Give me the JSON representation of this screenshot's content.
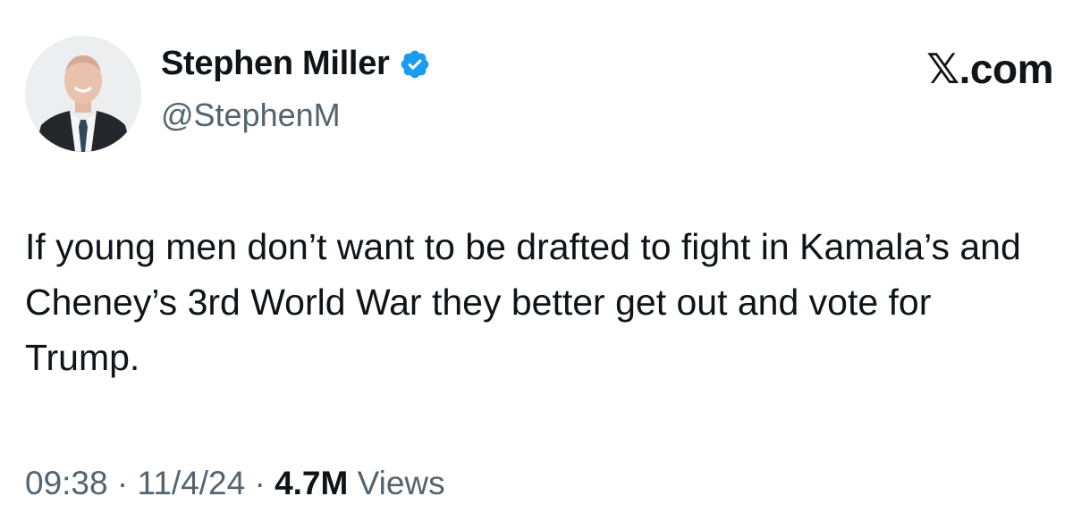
{
  "author": {
    "display_name": "Stephen Miller",
    "handle": "@StephenM",
    "verified": true,
    "verified_color": "#1d9bf0"
  },
  "brand": {
    "label": "𝕏.com"
  },
  "tweet": {
    "text": "If young men don’t want to be drafted to fight in Kamala’s and Cheney’s 3rd World War they better get out and vote for Trump."
  },
  "meta": {
    "time": "09:38",
    "date": "11/4/24",
    "separator": "·",
    "views_count": "4.7M",
    "views_label": "Views"
  },
  "colors": {
    "text_primary": "#0f1419",
    "text_secondary": "#536471"
  }
}
